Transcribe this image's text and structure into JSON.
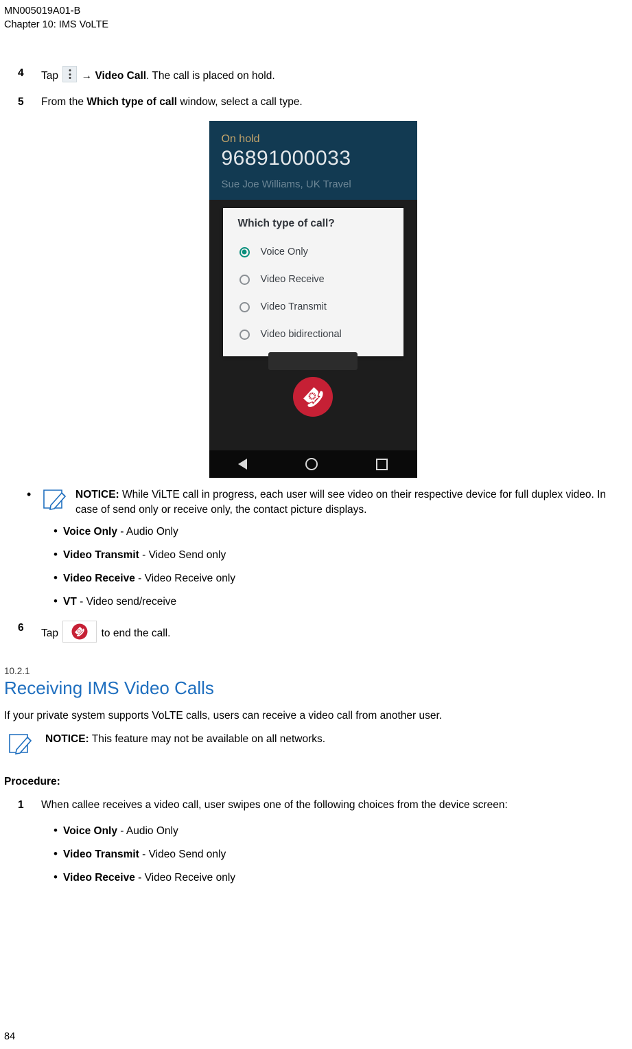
{
  "header": {
    "doc_id": "MN005019A01-B",
    "chapter": "Chapter 10:  IMS VoLTE"
  },
  "steps": [
    {
      "num": "4",
      "pre": "Tap",
      "icon": "overflow-menu-icon",
      "arrow": "→ ",
      "bold": "Video Call",
      "post": ". The call is placed on hold."
    },
    {
      "num": "5",
      "pre": "From the ",
      "bold": "Which type of call",
      "post": " window, select a call type."
    },
    {
      "num": "6",
      "pre": "Tap",
      "icon": "end-call-icon",
      "post": " to end the call."
    }
  ],
  "phone": {
    "status": "On hold",
    "number": "96891000033",
    "subtext": "Sue Joe Williams, UK Travel",
    "dialog_title": "Which type of call?",
    "options": [
      {
        "label": "Voice Only",
        "selected": true
      },
      {
        "label": "Video Receive",
        "selected": false
      },
      {
        "label": "Video Transmit",
        "selected": false
      },
      {
        "label": "Video bidirectional",
        "selected": false
      }
    ],
    "nav": {
      "back": "back-button",
      "home": "home-button",
      "recents": "recents-button"
    },
    "end_call": "end-call-button"
  },
  "notice1": {
    "label": "NOTICE:",
    "text": " While ViLTE call in progress, each user will see video on their respective device for full duplex video. In case of send only or receive only, the contact picture displays."
  },
  "call_types": [
    {
      "bold": "Voice Only",
      "rest": " - Audio Only"
    },
    {
      "bold": "Video Transmit",
      "rest": " - Video Send only"
    },
    {
      "bold": "Video Receive",
      "rest": " - Video Receive only"
    },
    {
      "bold": "VT",
      "rest": " - Video send/receive"
    }
  ],
  "section": {
    "number": "10.2.1",
    "title": "Receiving IMS Video Calls",
    "intro": "If your private system supports VoLTE calls, users can receive a video call from another user.",
    "notice_label": "NOTICE:",
    "notice_text": " This feature may not be available on all networks.",
    "procedure_label": "Procedure:",
    "step1_num": "1",
    "step1_text": "When callee receives a video call, user swipes one of the following choices from the device screen:",
    "step1_items": [
      {
        "bold": "Voice Only",
        "rest": " - Audio Only"
      },
      {
        "bold": "Video Transmit",
        "rest": " - Video Send only"
      },
      {
        "bold": "Video Receive",
        "rest": " - Video Receive only"
      }
    ]
  },
  "footer": {
    "page_number": "84"
  }
}
